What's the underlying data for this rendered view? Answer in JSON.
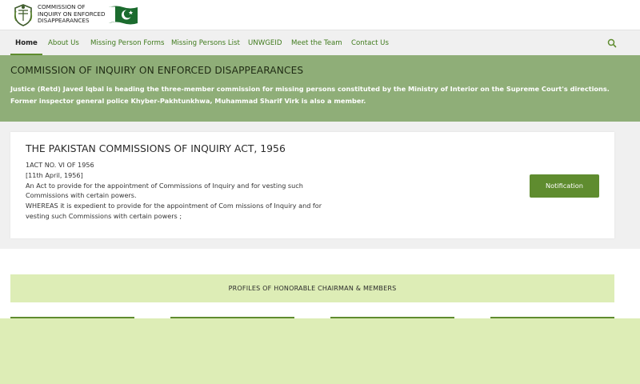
{
  "header": {
    "logo_line1": "Commission of",
    "logo_line2": "Inquiry on Enforced",
    "logo_line3": "Disappearances"
  },
  "nav": {
    "items": [
      {
        "label": "Home"
      },
      {
        "label": "About Us"
      },
      {
        "label": "Missing Person Forms"
      },
      {
        "label": "Missing Persons List"
      },
      {
        "label": "UNWGEID"
      },
      {
        "label": "Meet the Team"
      },
      {
        "label": "Contact Us"
      }
    ]
  },
  "hero": {
    "title": "COMMISSION OF INQUIRY ON ENFORCED DISAPPEARANCES",
    "text": "Justice (Retd) Javed Iqbal is heading the three-member commission for missing persons constituted by the Ministry of Interior on the Supreme Court's directions. Former inspector general police Khyber-Pakhtunkhwa, Muhammad Sharif Virk is also a member."
  },
  "act": {
    "title": "THE PAKISTAN COMMISSIONS OF INQUIRY ACT, 1956",
    "lines": [
      "1ACT NO. VI OF 1956",
      "[11th April, 1956]",
      "An Act to provide for the appointment of Commissions of Inquiry and for vesting such",
      "Commissions with certain powers.",
      "WHEREAS it is expedient to provide for the appointment of Com missions of Inquiry and for",
      "vesting such Commissions with certain powers ;"
    ],
    "button_label": "Notification"
  },
  "profiles": {
    "heading": "PROFILES OF HONORABLE CHAIRMAN & MEMBERS"
  },
  "colors": {
    "accent": "#5f8c2f",
    "hero_bg": "#8fae78",
    "light_green": "#ddedb6",
    "nav_bg": "#f0f0f0"
  },
  "icons": {
    "emblem": "state-emblem-icon",
    "flag": "pakistan-flag-icon",
    "search": "search-icon"
  }
}
